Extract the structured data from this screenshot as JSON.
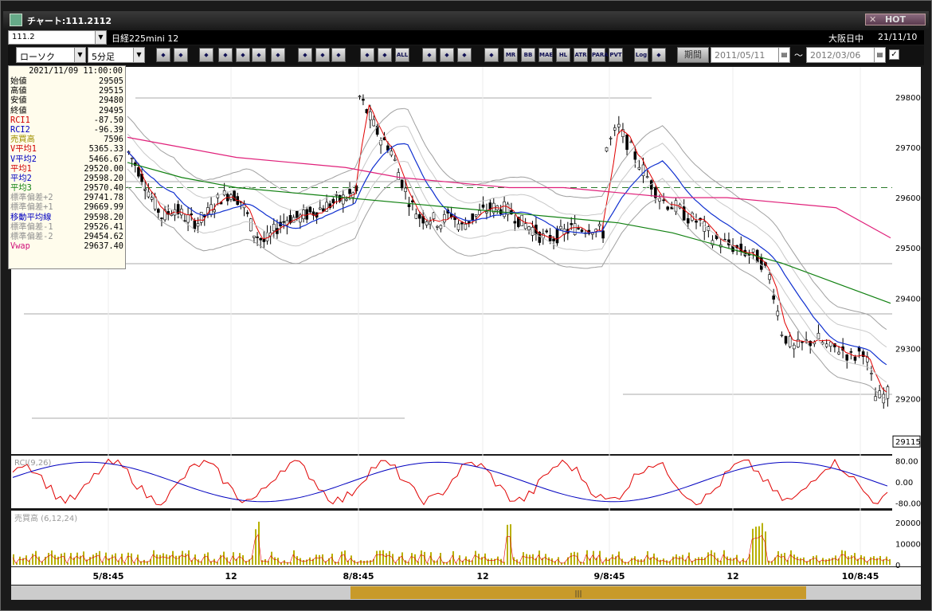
{
  "window": {
    "title": "チャート:111.2112",
    "hot_label": "HOT"
  },
  "info_bar": {
    "symbol_code": "111.2",
    "instrument": "日経225mini 12",
    "market": "大阪日中",
    "base_date": "21/11/10"
  },
  "toolbar": {
    "chart_type": "ローソク",
    "timeframe": "5分足",
    "buttons": [
      "zoom",
      "crosshair",
      "download",
      "search",
      "chart-a",
      "chart-b",
      "blank",
      "draw",
      "cursor",
      "flag",
      "candle-a",
      "candle-b",
      "ALL",
      "gear",
      "brush",
      "palette",
      "volume-profile",
      "MR",
      "BB",
      "MAE",
      "HL",
      "ATR",
      "PARA",
      "PVT",
      "Log",
      "export"
    ],
    "period_label": "期間",
    "date_from": "2011/05/11",
    "date_to": "2012/03/06",
    "tilde": "〜"
  },
  "colors": {
    "up": "#d8d8d8",
    "down": "#000000",
    "rci1": "#e00000",
    "rci2": "#0000c0",
    "ma1": "#e00000",
    "ma2": "#1030d0",
    "ma3": "#108010",
    "vwap": "#e0207a",
    "bands": "#a0a0a0",
    "volume": "#b8b000"
  },
  "info_panel": {
    "datetime": "2021/11/09 11:00:00",
    "rows": [
      {
        "label": "始値",
        "value": "29505",
        "color": "#000000"
      },
      {
        "label": "高値",
        "value": "29515",
        "color": "#000000"
      },
      {
        "label": "安値",
        "value": "29480",
        "color": "#000000"
      },
      {
        "label": "終値",
        "value": "29495",
        "color": "#000000"
      },
      {
        "label": "RCI1",
        "value": "-87.50",
        "color": "#d00000"
      },
      {
        "label": "RCI2",
        "value": "-96.39",
        "color": "#0000c0"
      },
      {
        "label": "売買高",
        "value": "7596",
        "color": "#a09000"
      },
      {
        "label": "V平均1",
        "value": "5365.33",
        "color": "#d00000"
      },
      {
        "label": "V平均2",
        "value": "5466.67",
        "color": "#0000c0"
      },
      {
        "label": "平均1",
        "value": "29520.00",
        "color": "#d00000"
      },
      {
        "label": "平均2",
        "value": "29598.20",
        "color": "#0000c0"
      },
      {
        "label": "平均3",
        "value": "29570.40",
        "color": "#108010"
      },
      {
        "label": "標準偏差+2",
        "value": "29741.78",
        "color": "#909090"
      },
      {
        "label": "標準偏差+1",
        "value": "29669.99",
        "color": "#909090"
      },
      {
        "label": "移動平均線",
        "value": "29598.20",
        "color": "#0000c0"
      },
      {
        "label": "標準偏差-1",
        "value": "29526.41",
        "color": "#909090"
      },
      {
        "label": "標準偏差-2",
        "value": "29454.62",
        "color": "#909090"
      },
      {
        "label": "Vwap",
        "value": "29637.40",
        "color": "#d0107a"
      }
    ]
  },
  "chart_data": {
    "type": "candlestick",
    "price_axis": {
      "ticks": [
        "29800",
        "29700",
        "29600",
        "29500",
        "29400",
        "29300",
        "29200"
      ],
      "ylim": [
        29090,
        29860
      ],
      "current_price": "29115"
    },
    "date_axis": {
      "ticks": [
        "5/8:45",
        "12",
        "8/8:45",
        "12",
        "9/8:45",
        "12",
        "10/8:45"
      ]
    },
    "reference_line": 29620,
    "price_segments": [
      [
        29690,
        29650,
        29600,
        29560,
        29580,
        29560,
        29550,
        29570,
        29600,
        29610,
        29590,
        29530,
        29510,
        29540,
        29560,
        29560,
        29570,
        29580,
        29590,
        29600,
        29610
      ],
      [
        29800,
        29760,
        29720,
        29700,
        29640,
        29590,
        29560,
        29560,
        29550,
        29570,
        29540,
        29560,
        29570,
        29580,
        29580,
        29570,
        29550,
        29540,
        29520,
        29520,
        29530,
        29540,
        29540,
        29540,
        29530
      ],
      [
        29700,
        29740,
        29700,
        29660,
        29620,
        29590,
        29580,
        29560,
        29550,
        29520,
        29510,
        29500,
        29490,
        29480,
        29440,
        29330,
        29300,
        29310,
        29320,
        29300,
        29300,
        29280,
        29300,
        29200,
        29210
      ]
    ],
    "rci_panel": {
      "label": "RCI(9,26)",
      "ticks": [
        "80.00",
        "0.00",
        "-80.00"
      ],
      "ylim": [
        -100,
        100
      ]
    },
    "volume_panel": {
      "label": "売買高 (6,12,24)",
      "ticks": [
        "20000",
        "10000",
        "0"
      ],
      "ylim": [
        0,
        25000
      ]
    },
    "series": [
      {
        "name": "Vwap",
        "values": [
          29720,
          29700,
          29680,
          29670,
          29660,
          29640,
          29630,
          29620,
          29620,
          29610,
          29600,
          29600,
          29590,
          29580,
          29520
        ]
      },
      {
        "name": "平均3",
        "values": [
          29670,
          29640,
          29620,
          29610,
          29600,
          29590,
          29580,
          29570,
          29560,
          29550,
          29530,
          29500,
          29470,
          29430,
          29390
        ]
      }
    ]
  }
}
